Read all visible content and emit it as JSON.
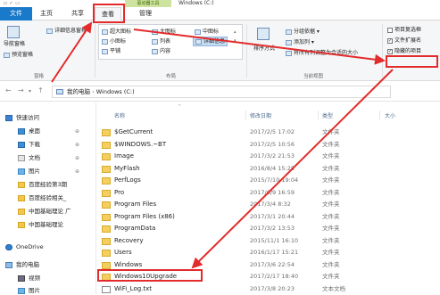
{
  "window": {
    "title": "Windows (C:)",
    "context_tab": "驱动器工具"
  },
  "tabs": {
    "file": "文件",
    "home": "主页",
    "share": "共享",
    "view": "查看",
    "manage": "管理"
  },
  "ribbon": {
    "nav_pane": "导航窗格",
    "preview_pane": "预览窗格",
    "details_pane": "详细信息窗格",
    "group_panes": "窗格",
    "layout": {
      "extra_large": "超大图标",
      "large": "大图标",
      "medium": "中图标",
      "small": "小图标",
      "list": "列表",
      "details": "详细信息",
      "tiles": "平铺",
      "content": "内容"
    },
    "group_layout": "布局",
    "sort_by": "排序方式",
    "group_by": "分组依据",
    "add_columns": "添加列",
    "size_all_columns": "将所有列调整为合适的大小",
    "group_current_view": "当前视图",
    "item_checkboxes": "项目复选框",
    "file_extensions": "文件扩展名",
    "hidden_items": "隐藏的项目",
    "hidden_items_checked": true,
    "file_extensions_checked": true,
    "item_checkboxes_checked": false
  },
  "address": {
    "path_pc": "我的电脑",
    "path_drive": "Windows (C:)"
  },
  "sidebar": {
    "items": [
      {
        "label": "快速访问",
        "icon": "star-icon"
      },
      {
        "label": "桌面",
        "icon": "desktop-icon"
      },
      {
        "label": "下载",
        "icon": "download-icon"
      },
      {
        "label": "文档",
        "icon": "document-icon"
      },
      {
        "label": "图片",
        "icon": "picture-icon"
      },
      {
        "label": "百度经验第3期",
        "icon": "folder-icon"
      },
      {
        "label": "百度经验相关_",
        "icon": "folder-icon"
      },
      {
        "label": "中国基础理论 广",
        "icon": "folder-icon"
      },
      {
        "label": "中国基础理论",
        "icon": "folder-icon"
      },
      {
        "label": "OneDrive",
        "icon": "cloud-icon"
      },
      {
        "label": "我的电脑",
        "icon": "computer-icon"
      },
      {
        "label": "视频",
        "icon": "video-icon"
      },
      {
        "label": "图片",
        "icon": "picture-icon"
      }
    ]
  },
  "columns": {
    "name": "名称",
    "date": "修改日期",
    "type": "类型",
    "size": "大小"
  },
  "files": [
    {
      "name": "$GetCurrent",
      "date": "2017/2/5 17:02",
      "type": "文件夹"
    },
    {
      "name": "$WINDOWS.~BT",
      "date": "2017/2/5 10:56",
      "type": "文件夹"
    },
    {
      "name": "Image",
      "date": "2017/3/2 21:53",
      "type": "文件夹"
    },
    {
      "name": "MyFlash",
      "date": "2016/8/4 15:25",
      "type": "文件夹"
    },
    {
      "name": "PerfLogs",
      "date": "2015/7/10 19:04",
      "type": "文件夹"
    },
    {
      "name": "Pro",
      "date": "2017/6/9 16:59",
      "type": "文件夹"
    },
    {
      "name": "Program Files",
      "date": "2017/3/4 8:32",
      "type": "文件夹"
    },
    {
      "name": "Program Files (x86)",
      "date": "2017/3/1 20:44",
      "type": "文件夹"
    },
    {
      "name": "ProgramData",
      "date": "2017/3/2 13:53",
      "type": "文件夹"
    },
    {
      "name": "Recovery",
      "date": "2015/11/1 16:10",
      "type": "文件夹"
    },
    {
      "name": "Users",
      "date": "2016/1/17 15:21",
      "type": "文件夹"
    },
    {
      "name": "Windows",
      "date": "2017/3/6 22:54",
      "type": "文件夹"
    },
    {
      "name": "Windows10Upgrade",
      "date": "2017/2/17 18:40",
      "type": "文件夹"
    },
    {
      "name": "WiFi_Log.txt",
      "date": "2017/3/8 20:23",
      "type": "文本文档"
    }
  ]
}
